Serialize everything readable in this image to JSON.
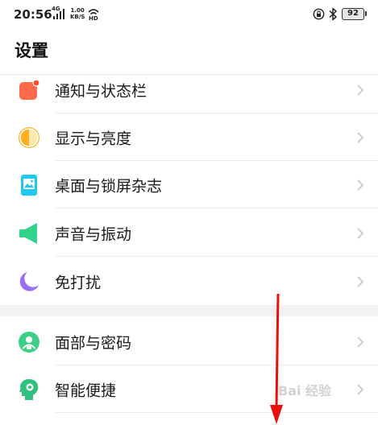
{
  "status_bar": {
    "time": "20:56",
    "network": "4G",
    "speed_value": "1.00",
    "speed_unit": "KB/S",
    "hd_label": "HD",
    "battery": "92"
  },
  "page": {
    "title": "设置"
  },
  "items": [
    {
      "label": "通知与状态栏",
      "icon": "notification-icon",
      "color": "#ff6b4a"
    },
    {
      "label": "显示与亮度",
      "icon": "display-brightness-icon",
      "color": "#ffb020"
    },
    {
      "label": "桌面与锁屏杂志",
      "icon": "wallpaper-icon",
      "color": "#1ec8f0"
    },
    {
      "label": "声音与振动",
      "icon": "speaker-icon",
      "color": "#2fd38a"
    },
    {
      "label": "免打扰",
      "icon": "moon-icon",
      "color": "#9b6ef3"
    },
    {
      "label": "面部与密码",
      "icon": "face-password-icon",
      "color": "#3ccf85"
    },
    {
      "label": "智能便捷",
      "icon": "smart-assist-icon",
      "color": "#2ec27e"
    }
  ],
  "watermark": "Bai 经验"
}
